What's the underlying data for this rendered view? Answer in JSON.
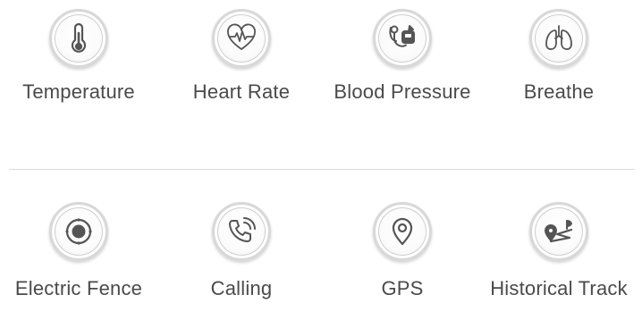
{
  "features_top": [
    {
      "label": "Temperature",
      "icon": "thermometer-icon"
    },
    {
      "label": "Heart Rate",
      "icon": "heart-pulse-icon"
    },
    {
      "label": "Blood Pressure",
      "icon": "blood-pressure-icon"
    },
    {
      "label": "Breathe",
      "icon": "lungs-icon"
    }
  ],
  "features_bottom": [
    {
      "label": "Electric Fence",
      "icon": "target-icon"
    },
    {
      "label": "Calling",
      "icon": "phone-icon"
    },
    {
      "label": "GPS",
      "icon": "location-pin-icon"
    },
    {
      "label": "Historical Track",
      "icon": "track-route-icon"
    }
  ],
  "colors": {
    "icon_stroke": "#555555",
    "label_text": "#4a4a4a",
    "divider": "#dcdcdc"
  }
}
